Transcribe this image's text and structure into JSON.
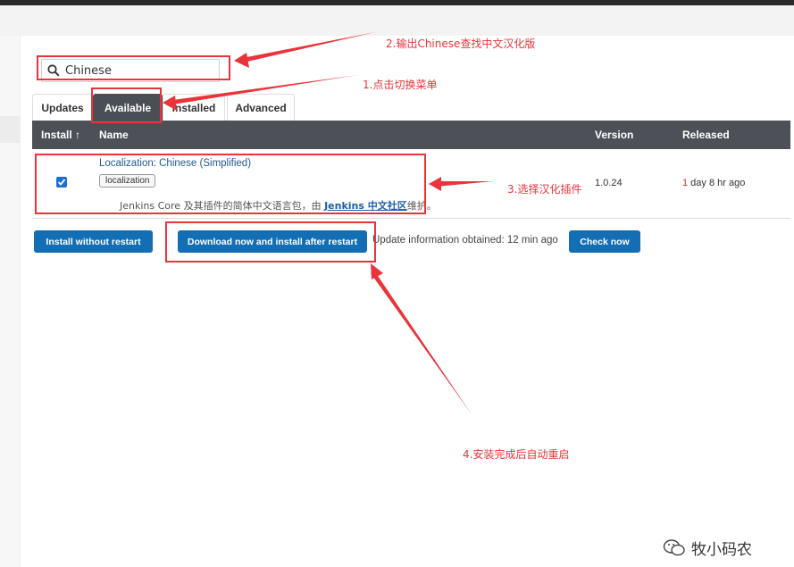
{
  "search": {
    "value": "Chinese"
  },
  "tabs": [
    {
      "label": "Updates"
    },
    {
      "label": "Available"
    },
    {
      "label": "Installed"
    },
    {
      "label": "Advanced"
    }
  ],
  "table": {
    "columns": [
      "Install ↑",
      "Name",
      "Version",
      "Released"
    ],
    "rows": [
      {
        "name": "Localization: Chinese (Simplified)",
        "tag": "localization",
        "desc_prefix": "Jenkins Core 及其插件的简体中文语言包，由 ",
        "desc_link": "Jenkins 中文社区",
        "desc_suffix": "维护。",
        "version": "1.0.24",
        "released_num": "1",
        "released_rest": " day 8 hr ago",
        "checked": true
      }
    ]
  },
  "buttons": {
    "install_without_restart": "Install without restart",
    "download_install_after_restart": "Download now and install after restart",
    "check_now": "Check now"
  },
  "update_info": "Update information obtained: 12 min ago",
  "annotations": {
    "step1": "1.点击切换菜单",
    "step2": "2.输出Chinese查找中文汉化版",
    "step3": "3.选择汉化插件",
    "step4": "4.安装完成后自动重启"
  },
  "watermark": "牧小码农",
  "colors": {
    "annotation_red": "#e8343a",
    "button_blue": "#146eb4",
    "header_dark": "#4d5157"
  }
}
